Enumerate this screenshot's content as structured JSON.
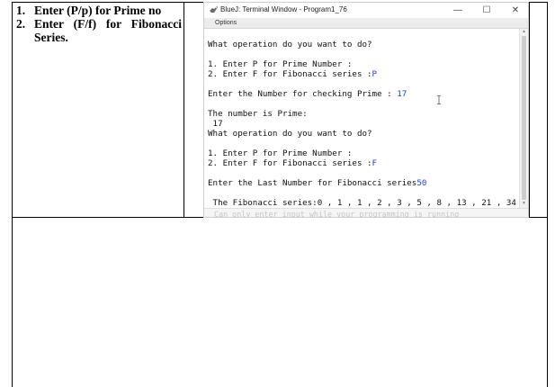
{
  "instructions": [
    {
      "num": "1.",
      "text": "Enter (P/p) for Prime no"
    },
    {
      "num": "2.",
      "text_line1": "Enter (F/f) for Fibonacci",
      "text_line2": "Series."
    }
  ],
  "window": {
    "title": "BlueJ: Terminal Window - Program1_76",
    "minimize": "—",
    "maximize": "☐",
    "close": "✕",
    "app_icon": "bluej-bird-icon"
  },
  "menu": {
    "options_label": "Options"
  },
  "console": {
    "lines": [
      {
        "text": "What operation do you want to do?"
      },
      {
        "text": "1. Enter P for Prime Number :"
      },
      {
        "text": "2. Enter F for Fibonacci series :",
        "input": "P"
      },
      {
        "text": "Enter the Number for checking Prime : ",
        "input": "17"
      },
      {
        "text": "The number is Prime:"
      },
      {
        "text": " 17"
      },
      {
        "text": "What operation do you want to do?"
      },
      {
        "text": "1. Enter P for Prime Number :"
      },
      {
        "text": "2. Enter F for Fibonacci series :",
        "input": "F"
      },
      {
        "text": "Enter the Last Number for Fibonacci series",
        "input": "50"
      },
      {
        "text": " The Fibonacci series:0 , 1 , 1 , 2 , 3 , 5 , 8 , 13 , 21 , 34"
      }
    ]
  },
  "input_bar": {
    "placeholder": "Can only enter input while your programming is running"
  }
}
